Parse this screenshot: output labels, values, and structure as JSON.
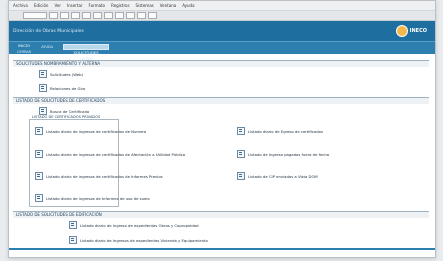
{
  "menubar": {
    "items": [
      "Archivo",
      "Edición",
      "Ver",
      "Insertar",
      "Formato",
      "Registros",
      "Sistemas",
      "Ventana",
      "Ayuda"
    ]
  },
  "toolbar": {
    "buttons": [
      "",
      "",
      "",
      "",
      "",
      "",
      "",
      "",
      "",
      "",
      ""
    ]
  },
  "header": {
    "title": "Dirección de Obras Municipales",
    "logo_text": "INECO",
    "bg": "#1f6ea0"
  },
  "nav": {
    "items": [
      {
        "label": "INICIO",
        "sub": "CERRAR"
      },
      {
        "label": "",
        "sub": "AYUDA"
      },
      {
        "label": "SOLICITUDES",
        "sub": "LISTAS"
      }
    ]
  },
  "sections": {
    "s1": "SOLICITUDES NOMBRAMIENTO Y ALTERNA",
    "s2": "LISTADO DE SOLICITUDES DE CERTIFICADOS",
    "s3": "LISTADO DE SOLICITUDES DE EDIFICACIÓN"
  },
  "group_title": "LISTADO DE CERTIFICADOS PRIVADOS",
  "rows": {
    "r1": "Solicitudes (Web)",
    "r2": "Relaciones de Giro",
    "r3": "Busca de Certificado",
    "c1": "Listado diario de ingresos de certificados de Numero",
    "c2": "Listado diario de ingresos de certificados de Afectación a Utilidad Pública",
    "c3": "Listado diario de ingresos de certificados de Informes Previos",
    "c4": "Listado diario de ingresos de Informes de uso de suelo",
    "d1": "Listado diario de Egreso de certificados",
    "d2": "Listado de Ingreso pagados fuera de fecha",
    "d3": "Listado de CIP enviados a Vista DOM",
    "e1": "Listado diario de Ingreso de expedientes Obras y Copropiedad",
    "e2": "Listado diario de Ingresos de expedientes Vivienda y Equipamiento"
  }
}
